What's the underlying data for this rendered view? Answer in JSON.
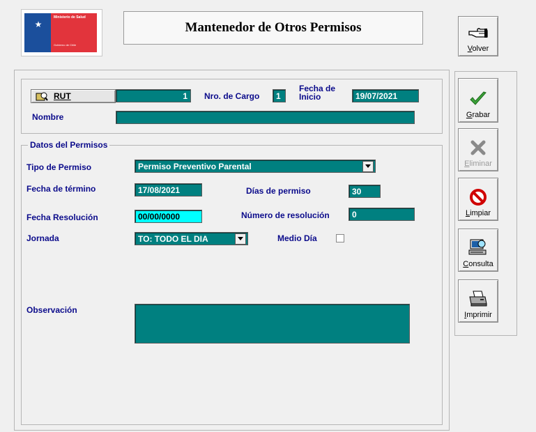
{
  "header": {
    "title": "Mantenedor de Otros Permisos",
    "logo_line1": "Ministerio de Salud",
    "logo_line2": "Gobierno de Chile"
  },
  "toolbar": {
    "volver": {
      "pre": "",
      "u": "V",
      "post": "olver",
      "icon": "pointing-hand-icon"
    },
    "grabar": {
      "pre": "",
      "u": "G",
      "post": "rabar",
      "icon": "checkmark-icon"
    },
    "eliminar": {
      "pre": "",
      "u": "E",
      "post": "liminar",
      "icon": "x-icon",
      "disabled": true
    },
    "limpiar": {
      "pre": "",
      "u": "L",
      "post": "impiar",
      "icon": "no-symbol-icon"
    },
    "consulta": {
      "pre": "",
      "u": "C",
      "post": "onsulta",
      "icon": "computer-search-icon"
    },
    "imprimir": {
      "pre": "",
      "u": "I",
      "post": "mprimir",
      "icon": "printer-icon"
    }
  },
  "employee": {
    "rut_label": "RUT",
    "rut_value": "1",
    "cargo_label": "Nro. de Cargo",
    "cargo_value": "1",
    "fecha_inicio_label_1": "Fecha de",
    "fecha_inicio_label_2": "Inicio",
    "fecha_inicio_value": "19/07/2021",
    "nombre_label": "Nombre",
    "nombre_value": ""
  },
  "permiso": {
    "group_title": "Datos del Permisos",
    "tipo_label": "Tipo de Permiso",
    "tipo_value": "Permiso Preventivo Parental",
    "fecha_termino_label": "Fecha de término",
    "fecha_termino_value": "17/08/2021",
    "dias_label": "Días de permiso",
    "dias_value": "30",
    "fecha_resolucion_label": "Fecha Resolución",
    "fecha_resolucion_value": "00/00/0000",
    "num_resolucion_label": "Número de resolución",
    "num_resolucion_value": "0",
    "jornada_label": "Jornada",
    "jornada_value": "TO: TODO EL DIA",
    "medio_dia_label": "Medio Día",
    "medio_dia_checked": false,
    "observacion_label": "Observación",
    "observacion_value": ""
  }
}
